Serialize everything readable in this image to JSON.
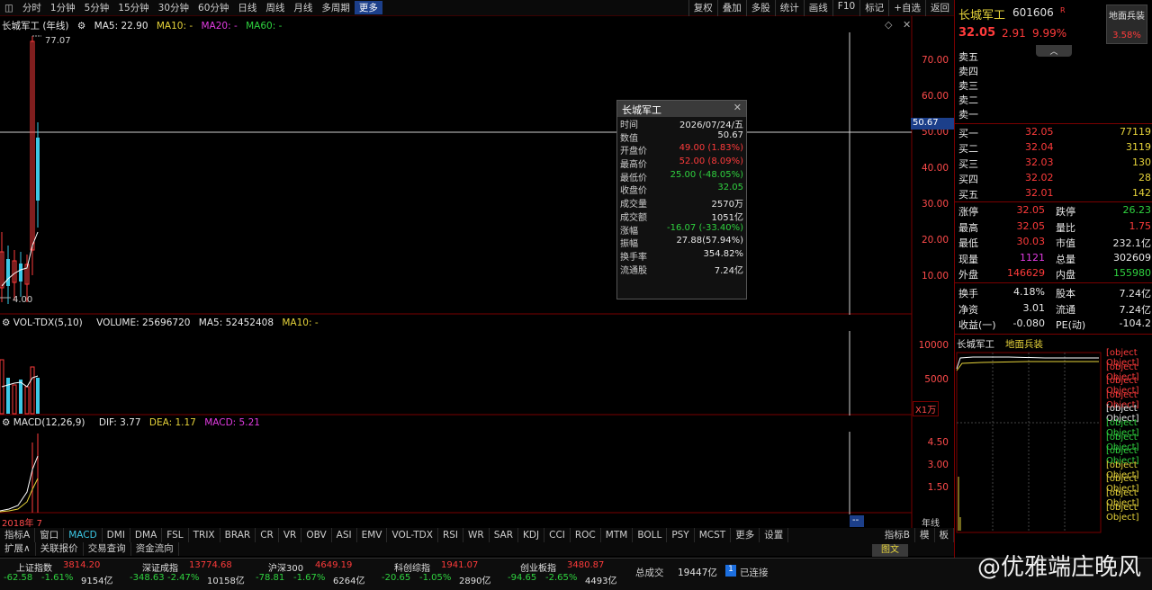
{
  "topbar": {
    "periods": [
      "分时",
      "1分钟",
      "5分钟",
      "15分钟",
      "30分钟",
      "60分钟",
      "日线",
      "周线",
      "月线",
      "多周期",
      "更多"
    ],
    "active_period": "更多",
    "tools": [
      "复权",
      "叠加",
      "多股",
      "统计",
      "画线",
      "F10",
      "标记",
      "+自选",
      "返回"
    ]
  },
  "main_chart": {
    "legend_name": "长城军工 (年线)",
    "ma5": "MA5: 22.90",
    "ma10": "MA10: -",
    "ma20": "MA20: -",
    "ma60": "MA60: -",
    "high_label": "77.07",
    "low_label": "4.00",
    "crosshair_price": "50.67",
    "yticks": [
      "70.00",
      "60.00",
      "50.00",
      "40.00",
      "30.00",
      "20.00",
      "10.00"
    ]
  },
  "vol_chart": {
    "legend_name": "VOL-TDX(5,10)",
    "volume": "VOLUME: 25696720",
    "ma5": "MA5: 52452408",
    "ma10": "MA10: -",
    "yticks": [
      "10000",
      "5000"
    ],
    "unit": "X1万"
  },
  "macd_chart": {
    "legend_name": "MACD(12,26,9)",
    "dif": "DIF: 3.77",
    "dea": "DEA: 1.17",
    "macd": "MACD: 5.21",
    "yticks": [
      "4.50",
      "3.00",
      "1.50"
    ],
    "date_label": "2018年 7",
    "xaxis_right": "年线"
  },
  "popup": {
    "title": "长城军工",
    "rows": [
      {
        "k": "时间",
        "v": "2026/07/24/五",
        "c": "white"
      },
      {
        "k": "数值",
        "v": "50.67",
        "c": "white"
      },
      {
        "k": "开盘价",
        "v": "49.00 (1.83%)",
        "c": "red"
      },
      {
        "k": "最高价",
        "v": "52.00 (8.09%)",
        "c": "red"
      },
      {
        "k": "最低价",
        "v": "25.00 (-48.05%)",
        "c": "green"
      },
      {
        "k": "收盘价",
        "v": "32.05",
        "c": "green"
      },
      {
        "k": "成交量",
        "v": "2570万",
        "c": "white"
      },
      {
        "k": "成交额",
        "v": "1051亿",
        "c": "white"
      },
      {
        "k": "涨幅",
        "v": "-16.07 (-33.40%)",
        "c": "green"
      },
      {
        "k": "振幅",
        "v": "27.88(57.94%)",
        "c": "white"
      },
      {
        "k": "换手率",
        "v": "354.82%",
        "c": "white"
      },
      {
        "k": "流通股",
        "v": "7.24亿",
        "c": "white"
      }
    ]
  },
  "quote": {
    "name": "长城军工",
    "code": "601606",
    "badge": "R",
    "sector": "地面兵装",
    "sector_pct": "3.58%",
    "price": "32.05",
    "change": "2.91",
    "change_pct": "9.99%",
    "sell_levels": [
      "卖五",
      "卖四",
      "卖三",
      "卖二",
      "卖一"
    ],
    "buy_levels": [
      {
        "label": "买一",
        "price": "32.05",
        "vol": "77119"
      },
      {
        "label": "买二",
        "price": "32.04",
        "vol": "3119"
      },
      {
        "label": "买三",
        "price": "32.03",
        "vol": "130"
      },
      {
        "label": "买四",
        "price": "32.02",
        "vol": "28"
      },
      {
        "label": "买五",
        "price": "32.01",
        "vol": "142"
      }
    ],
    "stats": [
      {
        "l1": "涨停",
        "v1": "32.05",
        "c1": "red",
        "l2": "跌停",
        "v2": "26.23",
        "c2": "green"
      },
      {
        "l1": "最高",
        "v1": "32.05",
        "c1": "red",
        "l2": "量比",
        "v2": "1.75",
        "c2": "red"
      },
      {
        "l1": "最低",
        "v1": "30.03",
        "c1": "red",
        "l2": "市值",
        "v2": "232.1亿",
        "c2": "white"
      },
      {
        "l1": "现量",
        "v1": "1121",
        "c1": "magenta",
        "l2": "总量",
        "v2": "302609",
        "c2": "white"
      },
      {
        "l1": "外盘",
        "v1": "146629",
        "c1": "red",
        "l2": "内盘",
        "v2": "155980",
        "c2": "green"
      }
    ],
    "stats2": [
      {
        "l1": "换手",
        "v1": "4.18%",
        "l2": "股本",
        "v2": "7.24亿"
      },
      {
        "l1": "净资",
        "v1": "3.01",
        "l2": "流通",
        "v2": "7.24亿"
      },
      {
        "l1": "收益(一)",
        "v1": "-0.080",
        "l2": "PE(动)",
        "v2": "-104.2"
      }
    ],
    "mini_title": "长城军工",
    "mini_sector": "地面兵装",
    "mini_yticks": [
      {
        "v": "32.05",
        "c": "red"
      },
      {
        "v": "31.32",
        "c": "red"
      },
      {
        "v": "30.59",
        "c": "red"
      },
      {
        "v": "29.86",
        "c": "red"
      },
      {
        "v": "29.14",
        "c": "white"
      },
      {
        "v": "28.41",
        "c": "green"
      },
      {
        "v": "27.68",
        "c": "green"
      },
      {
        "v": "26.96",
        "c": "green"
      },
      {
        "v": "63097",
        "c": "yellow"
      },
      {
        "v": "47323",
        "c": "yellow"
      },
      {
        "v": "31549",
        "c": "yellow"
      },
      {
        "v": "15774",
        "c": "yellow"
      }
    ],
    "mini_tabs": [
      "图文"
    ]
  },
  "indicators": {
    "items": [
      "指标A",
      "窗口",
      "MACD",
      "DMI",
      "DMA",
      "FSL",
      "TRIX",
      "BRAR",
      "CR",
      "VR",
      "OBV",
      "ASI",
      "EMV",
      "VOL-TDX",
      "RSI",
      "WR",
      "SAR",
      "KDJ",
      "CCI",
      "ROC",
      "MTM",
      "BOLL",
      "PSY",
      "MCST",
      "更多",
      "设置"
    ],
    "active": "MACD",
    "right_items": [
      "指标B",
      "模",
      "板"
    ]
  },
  "links": [
    "扩展∧",
    "关联报价",
    "交易查询",
    "资金流向"
  ],
  "status": {
    "indices": [
      {
        "name": "上证指数",
        "val": "3814.20",
        "chg": "-62.58",
        "pct": "-1.61%",
        "amt": "9154亿"
      },
      {
        "name": "深证成指",
        "val": "13774.68",
        "chg": "-348.63",
        "pct": "-2.47%",
        "amt": "10158亿"
      },
      {
        "name": "沪深300",
        "val": "4649.19",
        "chg": "-78.81",
        "pct": "-1.67%",
        "amt": "6264亿"
      },
      {
        "name": "科创综指",
        "val": "1941.07",
        "chg": "-20.65",
        "pct": "-1.05%",
        "amt": "2890亿"
      },
      {
        "name": "创业板指",
        "val": "3480.87",
        "chg": "-94.65",
        "pct": "-2.65%",
        "amt": "4493亿"
      }
    ],
    "total_label": "总成交",
    "total": "19447亿",
    "conn": "已连接",
    "conn_badge": "1"
  },
  "watermark": "@优雅端庄晚风",
  "colors": {
    "up": "#ff3b3b",
    "down": "#2fd23f",
    "accent": "#1c3f8a",
    "frame": "#7a0000"
  }
}
